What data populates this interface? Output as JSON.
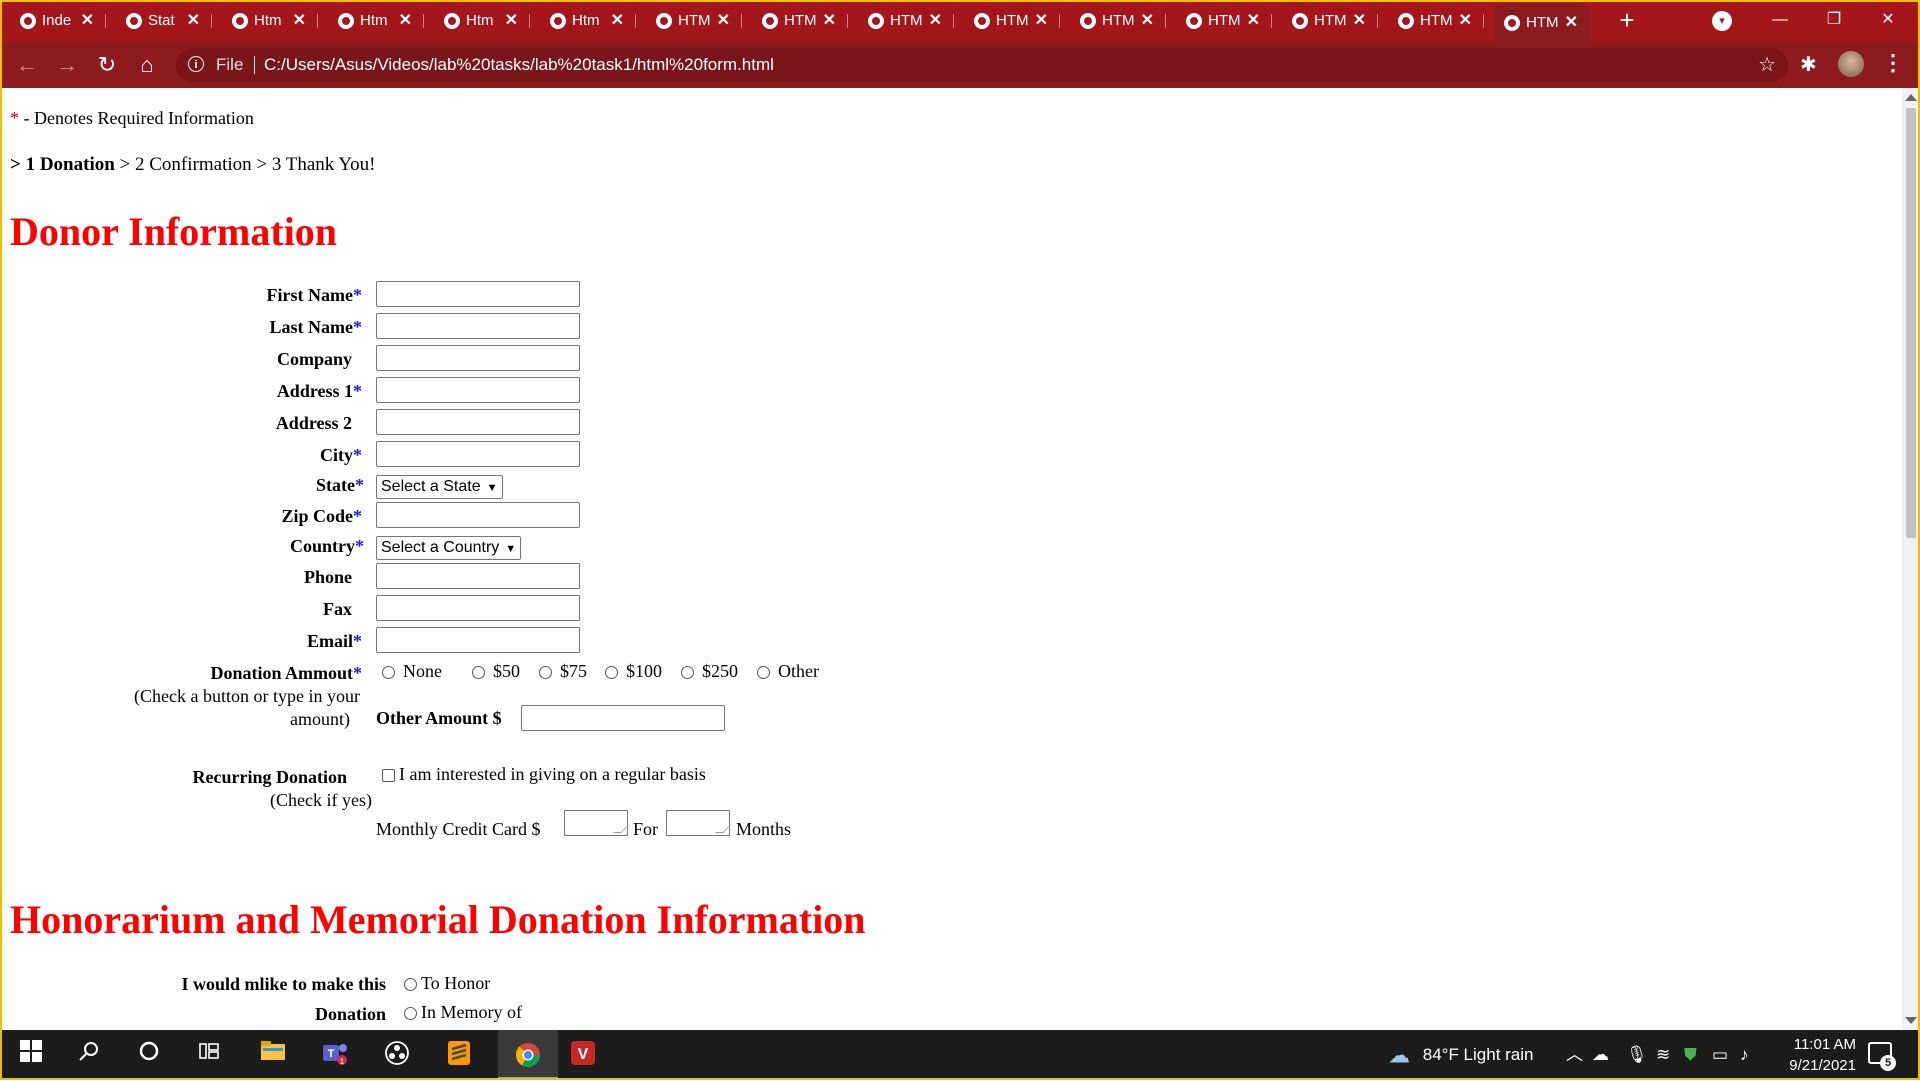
{
  "browser": {
    "tabs": [
      {
        "title": "Inde",
        "active": false
      },
      {
        "title": "Stat",
        "active": false
      },
      {
        "title": "Htm",
        "active": false
      },
      {
        "title": "Htm",
        "active": false
      },
      {
        "title": "Htm",
        "active": false
      },
      {
        "title": "Htm",
        "active": false
      },
      {
        "title": "HTM",
        "active": false
      },
      {
        "title": "HTM",
        "active": false
      },
      {
        "title": "HTM",
        "active": false
      },
      {
        "title": "HTM",
        "active": false
      },
      {
        "title": "HTM",
        "active": false
      },
      {
        "title": "HTM",
        "active": false
      },
      {
        "title": "HTM",
        "active": false
      },
      {
        "title": "HTM",
        "active": false
      },
      {
        "title": "HTM",
        "active": true
      }
    ],
    "scheme_label": "File",
    "url": "C:/Users/Asus/Videos/lab%20tasks/lab%20task1/html%20form.html",
    "icons": {
      "back": "←",
      "forward": "→",
      "reload": "↻",
      "home": "⌂",
      "bookmark": "☆",
      "extensions": "✱",
      "menu": "⋮",
      "new_tab": "+",
      "tab_search": "▾",
      "minimize": "—",
      "maximize": "❐",
      "close": "✕"
    }
  },
  "page": {
    "required_marker": "*",
    "required_note": " - Denotes Required Information",
    "steps": {
      "current": "> 1 Donation",
      "rest": " > 2 Confirmation > 3 Thank You!"
    },
    "section1_title": "Donor Information",
    "section2_title": "Honorarium and Memorial Donation Information",
    "fields": {
      "first_name": "First Name",
      "last_name": "Last Name",
      "company": "Company",
      "address1": "Address 1",
      "address2": "Address 2",
      "city": "City",
      "state": "State",
      "zip": "Zip Code",
      "country": "Country",
      "phone": "Phone",
      "fax": "Fax",
      "email": "Email"
    },
    "state_select": "Select a State",
    "country_select": "Select a Country",
    "donation": {
      "label": "Donation Ammout",
      "hint1": "(Check a button or type in your",
      "hint2": "amount)",
      "options": [
        "None",
        "$50",
        "$75",
        "$100",
        "$250",
        "Other"
      ],
      "other_label": "Other Amount $"
    },
    "recurring": {
      "label": "Recurring Donation",
      "hint": "(Check if yes)",
      "checkbox_text": "I am interested in giving on a regular basis",
      "monthly_label": "Monthly Credit Card $",
      "for_label": "For",
      "months_label": "Months"
    },
    "honor": {
      "label1": "I would mlike to make this",
      "label2": "Donation",
      "opt1": "To Honor",
      "opt2": "In Memory of"
    }
  },
  "taskbar": {
    "weather": "84°F  Light rain",
    "time": "11:01 AM",
    "date": "9/21/2021",
    "notification_count": "5",
    "teams_badge": "1"
  }
}
